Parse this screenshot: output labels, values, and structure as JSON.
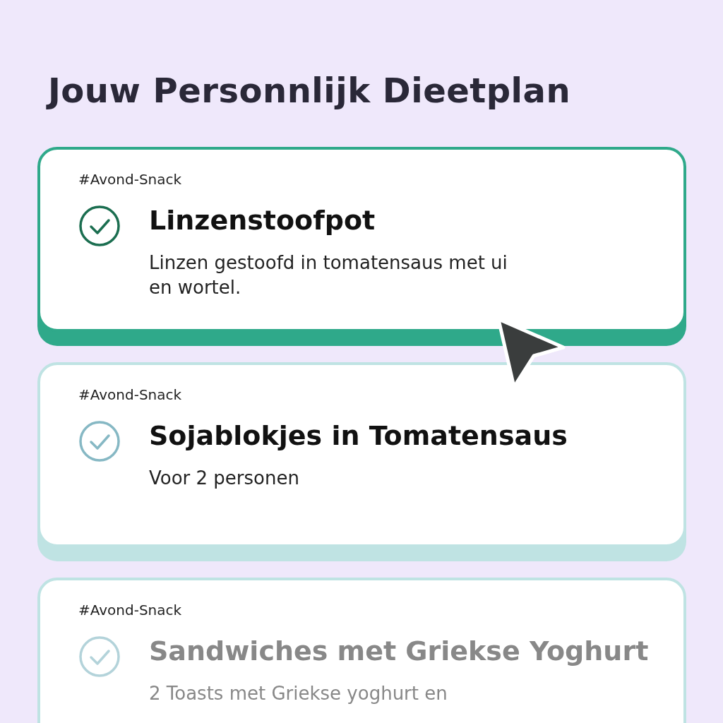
{
  "title": "Jouw Personnlijk Dieetplan",
  "meals": [
    {
      "tag": "#Avond-Snack",
      "name": "Linzenstoofpot",
      "description": "Linzen gestoofd in tomatensaus met ui en wortel.",
      "selected": true,
      "dimmed": false
    },
    {
      "tag": "#Avond-Snack",
      "name": "Sojablokjes in Tomatensaus",
      "description": "Voor 2 personen",
      "selected": false,
      "dimmed": false
    },
    {
      "tag": "#Avond-Snack",
      "name": "Sandwiches met Griekse Yoghurt",
      "description": "2 Toasts met Griekse yoghurt en",
      "selected": false,
      "dimmed": true
    }
  ]
}
